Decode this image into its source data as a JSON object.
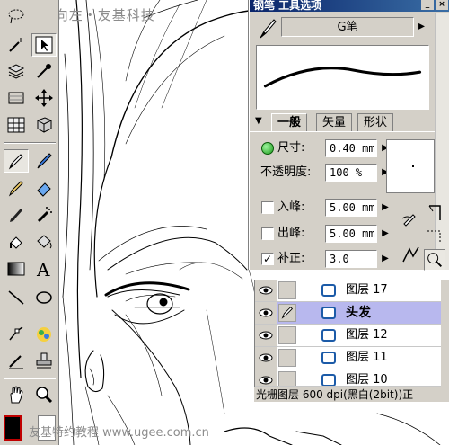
{
  "watermark": {
    "top_text": "向右向左・友基科技",
    "copyright_symbol": "©",
    "bottom_text": "友基特约教程 www.ugee.com.cn"
  },
  "toolbar": {
    "tools": [
      "lasso-icon",
      "magic-wand-icon",
      "arrow-select-icon",
      "layer-select-icon",
      "eyedropper-icon",
      "move-icon",
      "grid-icon",
      "object-icon",
      "pen-icon",
      "marker-icon",
      "pencil-icon",
      "eraser-icon",
      "brush-icon",
      "airbrush-icon",
      "fill-icon",
      "bucket-icon",
      "gradient-icon",
      "text-icon",
      "line-icon",
      "ellipse-icon",
      "pen-path-icon",
      "color-pen-icon",
      "ruler-icon",
      "stamp-icon",
      "hand-icon",
      "zoom-icon"
    ],
    "active_tool": "pen-icon",
    "foreground_color": "#000000",
    "background_color": "#ffffff"
  },
  "tool_options": {
    "title": "钢笔 工具选项",
    "brush_name": "G笔",
    "tabs": [
      "一般",
      "矢量",
      "形状"
    ],
    "active_tab": "一般",
    "size_label": "尺寸:",
    "size_value": "0.40 mm",
    "opacity_label": "不透明度:",
    "opacity_value": "100 %",
    "in_label": "入峰:",
    "in_value": "5.00 mm",
    "in_checked": false,
    "out_label": "出峰:",
    "out_value": "5.00 mm",
    "out_checked": false,
    "correction_label": "补正:",
    "correction_value": "3.0",
    "correction_checked": true
  },
  "layers": {
    "rows": [
      {
        "name": "图层 17",
        "selected": false
      },
      {
        "name": "头发",
        "selected": true
      },
      {
        "name": "图层 12",
        "selected": false
      },
      {
        "name": "图层 11",
        "selected": false
      },
      {
        "name": "图层 10",
        "selected": false
      }
    ],
    "status": "光栅图层 600 dpi(黑白(2bit))正"
  },
  "colors": {
    "panel_gray": "#d4d0c8",
    "title_blue": "#0a246a",
    "selected_row": "#b8b8ee",
    "layer_icon_blue": "#1c5ba8"
  }
}
